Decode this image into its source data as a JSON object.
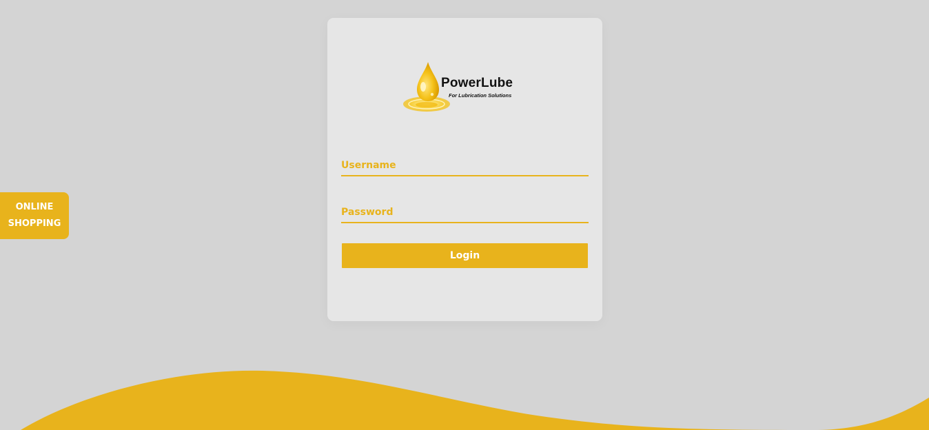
{
  "brand": {
    "name": "PowerLube",
    "tagline": "For Lubrication Solutions"
  },
  "login_form": {
    "username_placeholder": "Username",
    "password_placeholder": "Password",
    "username_value": "",
    "password_value": "",
    "login_label": "Login"
  },
  "side_tab": {
    "line1": "ONLINE",
    "line2": "SHOPPING"
  },
  "colors": {
    "accent": "#e8b31c",
    "background": "#d4d4d4",
    "card": "#e6e6e6"
  }
}
